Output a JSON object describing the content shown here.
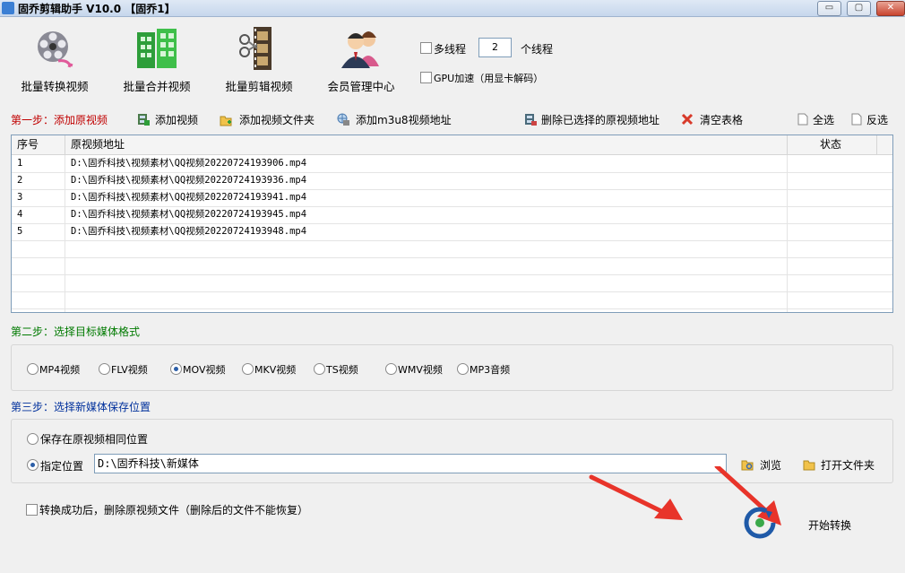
{
  "window": {
    "title": "固乔剪辑助手 V10.0 【固乔1】",
    "minimize_glyph": "▭",
    "maximize_glyph": "▢",
    "close_glyph": "✕"
  },
  "toolbar": {
    "batch_convert": "批量转换视频",
    "batch_merge": "批量合并视频",
    "batch_cut": "批量剪辑视频",
    "member_center": "会员管理中心"
  },
  "options": {
    "multithread_label": "多线程",
    "thread_count": "2",
    "thread_suffix": "个线程",
    "gpu_label": "GPU加速（用显卡解码）"
  },
  "step1": {
    "label": "第一步：添加原视频",
    "add_video": "添加视频",
    "add_folder": "添加视频文件夹",
    "add_m3u8": "添加m3u8视频地址",
    "delete_selected": "删除已选择的原视频地址",
    "clear_table": "清空表格",
    "select_all": "全选",
    "invert_selection": "反选"
  },
  "table": {
    "columns": [
      "序号",
      "原视频地址",
      "状态"
    ],
    "rows": [
      {
        "index": "1",
        "path": "D:\\固乔科技\\视频素材\\QQ视频20220724193906.mp4",
        "status": ""
      },
      {
        "index": "2",
        "path": "D:\\固乔科技\\视频素材\\QQ视频20220724193936.mp4",
        "status": ""
      },
      {
        "index": "3",
        "path": "D:\\固乔科技\\视频素材\\QQ视频20220724193941.mp4",
        "status": ""
      },
      {
        "index": "4",
        "path": "D:\\固乔科技\\视频素材\\QQ视频20220724193945.mp4",
        "status": ""
      },
      {
        "index": "5",
        "path": "D:\\固乔科技\\视频素材\\QQ视频20220724193948.mp4",
        "status": ""
      }
    ]
  },
  "step2": {
    "label": "第二步：选择目标媒体格式",
    "formats": [
      "MP4视频",
      "FLV视频",
      "MOV视频",
      "MKV视频",
      "TS视频",
      "WMV视频",
      "MP3音频"
    ],
    "selected": "MOV视频"
  },
  "step3": {
    "label": "第三步：选择新媒体保存位置",
    "same_location": "保存在原视频相同位置",
    "specify_location": "指定位置",
    "path": "D:\\固乔科技\\新媒体",
    "browse": "浏览",
    "open_folder": "打开文件夹"
  },
  "footer": {
    "delete_after": "转换成功后，删除原视频文件（删除后的文件不能恢复）",
    "start": "开始转换"
  },
  "colors": {
    "step1": "#c00000",
    "step2": "#007a00",
    "step3": "#00309c",
    "arrow": "#e8342a"
  }
}
